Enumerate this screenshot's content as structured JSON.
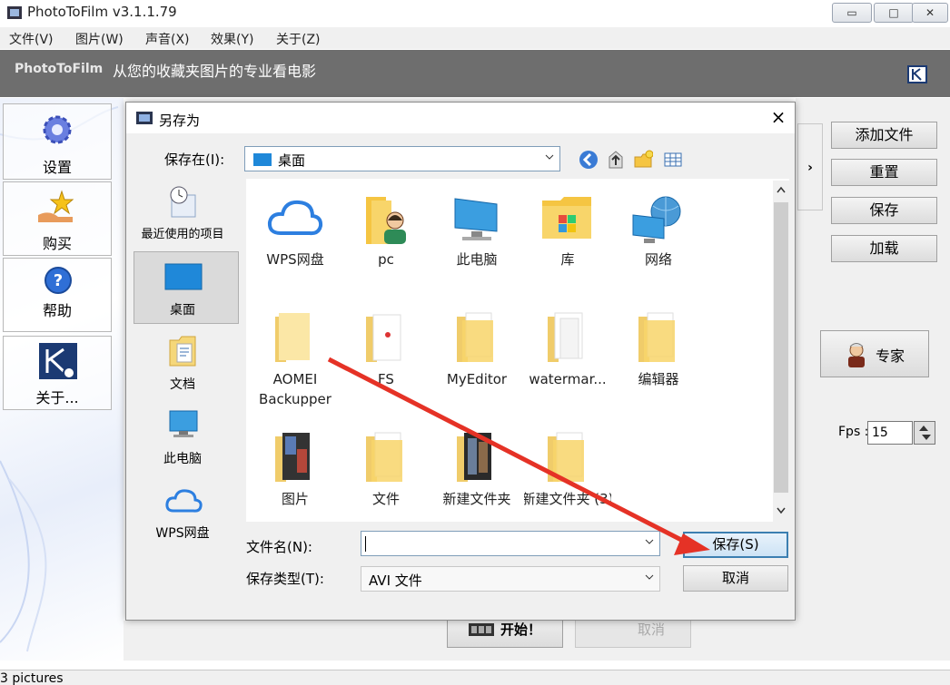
{
  "window": {
    "title": "PhotoToFilm v3.1.1.79",
    "minimize_label": "▭",
    "maximize_label": "□",
    "close_label": "✕"
  },
  "menu": [
    "文件(V)",
    "图片(W)",
    "声音(X)",
    "效果(Y)",
    "关于(Z)"
  ],
  "banner": {
    "brand": "PhotoToFilm",
    "slogan": "从您的收藏夹图片的专业看电影"
  },
  "sidebar": {
    "items": [
      {
        "label": "设置",
        "icon": "gear-icon"
      },
      {
        "label": "购买",
        "icon": "buy-icon"
      },
      {
        "label": "帮助",
        "icon": "help-icon"
      },
      {
        "label": "关于...",
        "icon": "app-logo-icon"
      }
    ]
  },
  "right_panel": {
    "buttons": [
      "添加文件",
      "重置",
      "保存",
      "加载"
    ],
    "expert_label": "专家",
    "fps_label": "Fps :",
    "fps_value": "15"
  },
  "bottom": {
    "start_label": "开始！",
    "cancel_label": "取消"
  },
  "status": {
    "text": "3 pictures"
  },
  "dialog": {
    "title": "另存为",
    "save_in_label": "保存在(I):",
    "save_in_value": "桌面",
    "places": [
      {
        "label": "最近使用的项目",
        "icon": "recent-icon"
      },
      {
        "label": "桌面",
        "icon": "desktop-icon"
      },
      {
        "label": "文档",
        "icon": "documents-icon"
      },
      {
        "label": "此电脑",
        "icon": "computer-icon"
      },
      {
        "label": "WPS网盘",
        "icon": "cloud-icon"
      }
    ],
    "files": [
      {
        "label": "WPS网盘",
        "icon": "cloud-icon"
      },
      {
        "label": "pc",
        "icon": "user-folder-icon"
      },
      {
        "label": "此电脑",
        "icon": "computer-icon"
      },
      {
        "label": "库",
        "icon": "library-icon"
      },
      {
        "label": "网络",
        "icon": "network-icon"
      },
      {
        "label": "AOMEI Backupper",
        "icon": "folder-icon"
      },
      {
        "label": "FS",
        "icon": "folder-icon"
      },
      {
        "label": "MyEditor",
        "icon": "folder-icon"
      },
      {
        "label": "watermar...",
        "icon": "folder-icon"
      },
      {
        "label": "编辑器",
        "icon": "folder-icon"
      },
      {
        "label": "图片",
        "icon": "pictures-folder-icon"
      },
      {
        "label": "文件",
        "icon": "folder-icon"
      },
      {
        "label": "新建文件夹",
        "icon": "folder-icon"
      },
      {
        "label": "新建文件夹 (3)",
        "icon": "folder-icon"
      }
    ],
    "filename_label": "文件名(N):",
    "filename_value": "",
    "filetype_label": "保存类型(T):",
    "filetype_value": "AVI 文件",
    "save_label": "保存(S)",
    "cancel_label": "取消",
    "colors": {
      "accent": "#3c7fb1",
      "arrow": "#e53226",
      "folder": "#f5d77a"
    }
  }
}
